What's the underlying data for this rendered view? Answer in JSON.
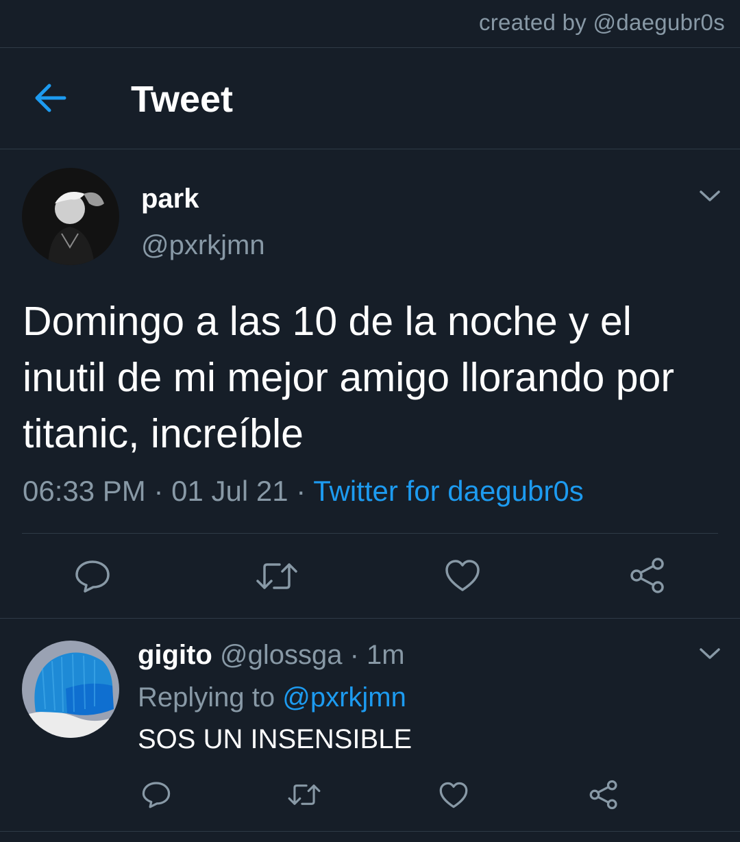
{
  "credit": "created by @daegubr0s",
  "header": {
    "title": "Tweet"
  },
  "tweet": {
    "display_name": "park",
    "handle": "@pxrkjmn",
    "text": "Domingo a las 10 de la noche y el inutil de mi mejor amigo llorando por titanic, increíble",
    "time": "06:33 PM",
    "date": "01 Jul 21",
    "separator": "·",
    "source": "Twitter for daegubr0s"
  },
  "reply": {
    "display_name": "gigito",
    "handle": "@glossga",
    "separator": "·",
    "age": "1m",
    "replying_prefix": "Replying to",
    "replying_to": "@pxrkjmn",
    "text": "SOS UN INSENSIBLE"
  },
  "icons": {
    "back": "arrow-left-icon",
    "more": "chevron-down-icon",
    "reply": "speech-bubble-icon",
    "retweet": "retweet-icon",
    "like": "heart-icon",
    "share": "share-icon"
  },
  "colors": {
    "background": "#161e28",
    "accent": "#1d9bf0",
    "muted": "#8899a6",
    "divider": "#2f3b47"
  }
}
